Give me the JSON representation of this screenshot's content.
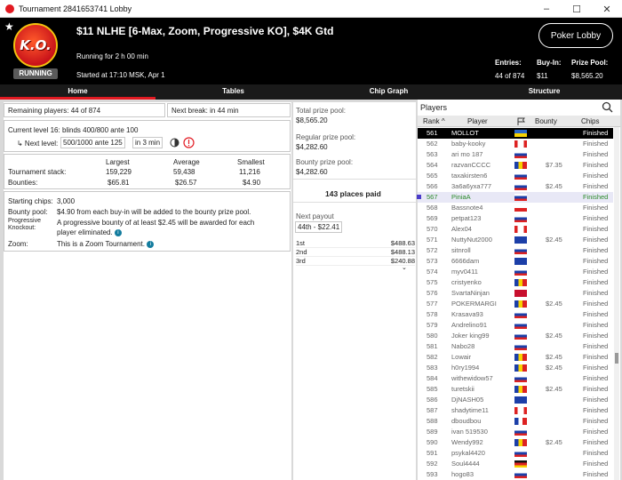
{
  "window": {
    "title": "Tournament 2841653741 Lobby",
    "minimize": "–",
    "maximize": "☐",
    "close": "✕"
  },
  "header": {
    "title": "$11 NLHE [6-Max, Zoom, Progressive KO], $4K Gtd",
    "logo_text": "K.O.",
    "status_badge": "RUNNING",
    "running_for": "Running for 2 h 00 min",
    "started_at": "Started at 17:10 MSK, Apr 1",
    "lobby_button": "Poker Lobby",
    "entries_label": "Entries:",
    "entries_value": "44 of 874",
    "buyin_label": "Buy-In:",
    "buyin_value": "$11",
    "prize_label": "Prize Pool:",
    "prize_value": "$8,565.20"
  },
  "tabs": [
    "Home",
    "Tables",
    "Chip Graph",
    "Structure"
  ],
  "home": {
    "remaining": "Remaining players: 44 of 874",
    "next_break": "Next break: in 44 min",
    "current_level_label": "Current level 16:",
    "current_level_value": "blinds 400/800 ante 100",
    "next_level_label": "↳ Next level:",
    "next_level_value": "500/1000 ante 125",
    "next_level_time": "in 3 min",
    "stack_headers": [
      "Largest",
      "Average",
      "Smallest"
    ],
    "stack_label": "Tournament stack:",
    "stack_values": [
      "159,229",
      "59,438",
      "11,216"
    ],
    "bounty_label": "Bounties:",
    "bounty_values": [
      "$65.81",
      "$26.57",
      "$4.90"
    ],
    "starting_chips_label": "Starting chips:",
    "starting_chips_value": "3,000",
    "bounty_pool_label": "Bounty pool:",
    "bounty_pool_value": "$4.90 from each buy-in will be added to the bounty prize pool.",
    "prog_label_1": "Progressive",
    "prog_label_2": "Knockout:",
    "prog_value_1": "A progressive bounty of at least $2.45 will be awarded for each",
    "prog_value_2": "player eliminated.",
    "zoom_label": "Zoom:",
    "zoom_value": "This is a Zoom Tournament."
  },
  "prizes": {
    "total_label": "Total prize pool:",
    "total_value": "$8,565.20",
    "regular_label": "Regular prize pool:",
    "regular_value": "$4,282.60",
    "bounty_label": "Bounty prize pool:",
    "bounty_value": "$4,282.60",
    "places_paid": "143 places paid",
    "next_payout_label": "Next payout",
    "next_payout_value": "44th - $22.41",
    "payouts": [
      {
        "place": "1st",
        "amount": "$488.63"
      },
      {
        "place": "2nd",
        "amount": "$488.13"
      },
      {
        "place": "3rd",
        "amount": "$240.88"
      }
    ]
  },
  "players": {
    "title": "Players",
    "headers": {
      "rank": "Rank",
      "player": "Player",
      "bounty": "Bounty",
      "chips": "Chips"
    },
    "rows": [
      {
        "rank": "561",
        "name": "MOLLOT",
        "flag": "ua",
        "bounty": "",
        "chips": "Finished"
      },
      {
        "rank": "562",
        "name": "baby-kooky",
        "flag": "ca",
        "bounty": "",
        "chips": "Finished"
      },
      {
        "rank": "563",
        "name": "ari mo 187",
        "flag": "ru",
        "bounty": "",
        "chips": "Finished"
      },
      {
        "rank": "564",
        "name": "razvanCCCC",
        "flag": "ro",
        "bounty": "$7.35",
        "chips": "Finished"
      },
      {
        "rank": "565",
        "name": "taxakirsten6",
        "flag": "ru",
        "bounty": "",
        "chips": "Finished"
      },
      {
        "rank": "566",
        "name": "3a6a6yxa777",
        "flag": "ru",
        "bounty": "$2.45",
        "chips": "Finished"
      },
      {
        "rank": "567",
        "name": "PiniaA",
        "flag": "ru",
        "bounty": "",
        "chips": "Finished"
      },
      {
        "rank": "568",
        "name": "Bassnote4",
        "flag": "cz",
        "bounty": "",
        "chips": "Finished"
      },
      {
        "rank": "569",
        "name": "petpat123",
        "flag": "ru",
        "bounty": "",
        "chips": "Finished"
      },
      {
        "rank": "570",
        "name": "Alex04",
        "flag": "ca",
        "bounty": "",
        "chips": "Finished"
      },
      {
        "rank": "571",
        "name": "NuttyNut2000",
        "flag": "gb",
        "bounty": "$2.45",
        "chips": "Finished"
      },
      {
        "rank": "572",
        "name": "sitnroll",
        "flag": "ru",
        "bounty": "",
        "chips": "Finished"
      },
      {
        "rank": "573",
        "name": "6666dam",
        "flag": "gb",
        "bounty": "",
        "chips": "Finished"
      },
      {
        "rank": "574",
        "name": "myv0411",
        "flag": "ru",
        "bounty": "",
        "chips": "Finished"
      },
      {
        "rank": "575",
        "name": "cristyenko",
        "flag": "ro",
        "bounty": "",
        "chips": "Finished"
      },
      {
        "rank": "576",
        "name": "SvartaNinjan",
        "flag": "no",
        "bounty": "",
        "chips": "Finished"
      },
      {
        "rank": "577",
        "name": "POKERMARGI",
        "flag": "ro",
        "bounty": "$2.45",
        "chips": "Finished"
      },
      {
        "rank": "578",
        "name": "Krasava93",
        "flag": "ru",
        "bounty": "",
        "chips": "Finished"
      },
      {
        "rank": "579",
        "name": "Andrelino91",
        "flag": "ru",
        "bounty": "",
        "chips": "Finished"
      },
      {
        "rank": "580",
        "name": "Joker king99",
        "flag": "ru",
        "bounty": "$2.45",
        "chips": "Finished"
      },
      {
        "rank": "581",
        "name": "Nabo28",
        "flag": "ru",
        "bounty": "",
        "chips": "Finished"
      },
      {
        "rank": "582",
        "name": "Lowair",
        "flag": "ro",
        "bounty": "$2.45",
        "chips": "Finished"
      },
      {
        "rank": "583",
        "name": "h0ry1994",
        "flag": "ro",
        "bounty": "$2.45",
        "chips": "Finished"
      },
      {
        "rank": "584",
        "name": "withewidow57",
        "flag": "ru",
        "bounty": "",
        "chips": "Finished"
      },
      {
        "rank": "585",
        "name": "turetskii",
        "flag": "ro",
        "bounty": "$2.45",
        "chips": "Finished"
      },
      {
        "rank": "586",
        "name": "DjNASH05",
        "flag": "gb",
        "bounty": "",
        "chips": "Finished"
      },
      {
        "rank": "587",
        "name": "shadytime11",
        "flag": "ca",
        "bounty": "",
        "chips": "Finished"
      },
      {
        "rank": "588",
        "name": "dboudbou",
        "flag": "fr",
        "bounty": "",
        "chips": "Finished"
      },
      {
        "rank": "589",
        "name": "ivan 519530",
        "flag": "ru",
        "bounty": "",
        "chips": "Finished"
      },
      {
        "rank": "590",
        "name": "Wendy992",
        "flag": "ro",
        "bounty": "$2.45",
        "chips": "Finished"
      },
      {
        "rank": "591",
        "name": "psykal4420",
        "flag": "ru",
        "bounty": "",
        "chips": "Finished"
      },
      {
        "rank": "592",
        "name": "Soul4444",
        "flag": "de",
        "bounty": "",
        "chips": "Finished"
      },
      {
        "rank": "593",
        "name": "hogo83",
        "flag": "ru",
        "bounty": "",
        "chips": "Finished"
      }
    ]
  },
  "colors": {
    "accent": "#e21a22",
    "selected_row": "#000000",
    "highlight_row_text": "#2b8a2b",
    "info": "#137c9e"
  }
}
